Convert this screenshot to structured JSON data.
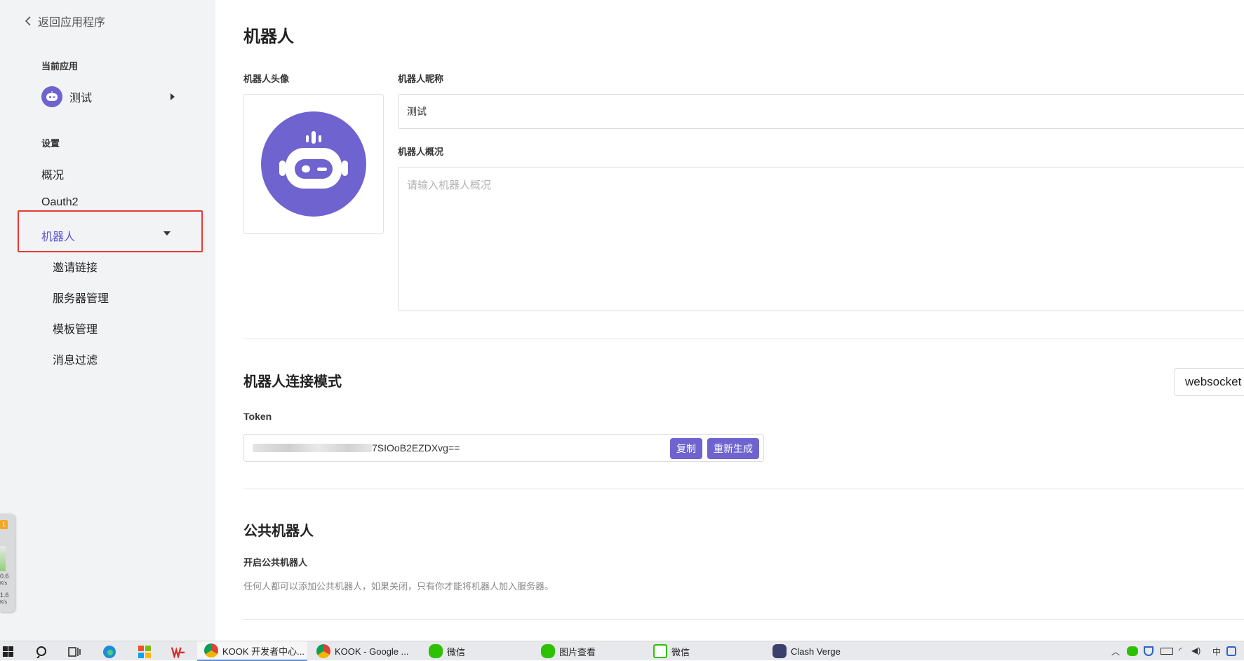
{
  "sidebar": {
    "back_label": "返回应用程序",
    "current_app_label": "当前应用",
    "current_app_name": "测试",
    "settings_label": "设置",
    "nav": [
      "概况",
      "Oauth2",
      "机器人"
    ],
    "sub_nav": [
      "邀请链接",
      "服务器管理",
      "模板管理",
      "消息过滤"
    ],
    "active_item": "机器人",
    "net_widget": {
      "badge": "1",
      "down": "0.6",
      "down_unit": "K/s",
      "up": "1.6",
      "up_unit": "K/s"
    }
  },
  "main": {
    "title": "机器人",
    "avatar_label": "机器人头像",
    "nickname_label": "机器人昵称",
    "nickname_value": "测试",
    "overview_label": "机器人概况",
    "overview_placeholder": "请输入机器人概况",
    "connection": {
      "title": "机器人连接模式",
      "mode": "websocket",
      "token_label": "Token",
      "token_visible": "7SIOoB2EZDXvg==",
      "copy_button": "复制",
      "regenerate_button": "重新生成"
    },
    "public_bot": {
      "title": "公共机器人",
      "toggle_label": "开启公共机器人",
      "help": "任何人都可以添加公共机器人，如果关闭，只有你才能将机器人加入服务器。"
    }
  },
  "taskbar": {
    "apps": [
      {
        "label": "KOOK 开发者中心...",
        "icon": "chrome-icon",
        "active": true
      },
      {
        "label": "KOOK - Google ...",
        "icon": "chrome-icon",
        "active": false
      },
      {
        "label": "微信",
        "icon": "wechat-icon",
        "active": false
      },
      {
        "label": "图片查看",
        "icon": "wechat-icon",
        "active": false
      },
      {
        "label": "微信",
        "icon": "wechat-window-icon",
        "active": false
      },
      {
        "label": "Clash Verge",
        "icon": "clash-cat-icon",
        "active": false
      }
    ],
    "ime": "中"
  },
  "colors": {
    "accent": "#6e63cf",
    "active_nav": "#5a55d2",
    "highlight_border": "#e53935",
    "sidebar_bg": "#f2f3f5"
  }
}
